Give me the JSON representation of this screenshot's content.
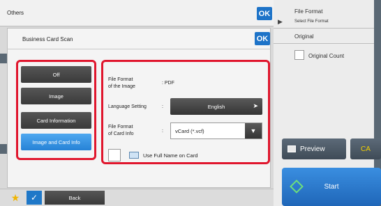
{
  "others_dialog": {
    "title": "Others",
    "ok_label": "OK"
  },
  "business_card_dialog": {
    "title": "Business Card Scan",
    "ok_label": "OK"
  },
  "modes": [
    {
      "label": "Off",
      "selected": false
    },
    {
      "label": "Image",
      "selected": false
    },
    {
      "label": "Card Information",
      "selected": false
    },
    {
      "label": "Image and Card Info",
      "selected": true
    }
  ],
  "settings": {
    "file_format_image_label_1": "File Format",
    "file_format_image_label_2": "of the Image",
    "file_format_image_value": ": PDF",
    "language_label": "Language Setting",
    "language_colon": ":",
    "language_value": "English",
    "file_format_card_label_1": "File Format",
    "file_format_card_label_2": "of Card Info",
    "file_format_card_colon": ":",
    "file_format_card_value": "vCard (*.vcf)",
    "use_full_name_label": "Use Full Name on Card"
  },
  "right_panel": {
    "file_format_title": "File Format",
    "file_format_sub": "Select File Format",
    "original": "Original",
    "original_count": "Original Count",
    "preview": "Preview",
    "ca": "CA",
    "start": "Start"
  },
  "bottom_bar": {
    "back": "Back"
  },
  "colors": {
    "highlight": "#e0162d",
    "selected": "#2682d6",
    "ok": "#1d73c8"
  }
}
